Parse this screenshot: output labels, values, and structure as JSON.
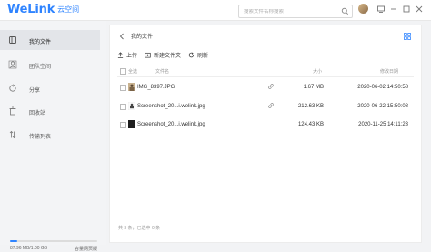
{
  "app": {
    "logo": "WeLink",
    "subtitle": "云空间"
  },
  "search": {
    "placeholder": "搜索文件名称搜索"
  },
  "sidebar": {
    "items": [
      {
        "label": "我的文件",
        "icon": "folder-icon"
      },
      {
        "label": "团队空间",
        "icon": "team-icon"
      },
      {
        "label": "分享",
        "icon": "share-icon"
      },
      {
        "label": "回收站",
        "icon": "trash-icon"
      },
      {
        "label": "传输列表",
        "icon": "transfer-icon"
      }
    ],
    "storage": {
      "used_text": "87.96 MB/1.00 GB",
      "upgrade_label": "容量网页版",
      "used_fraction": 0.086
    }
  },
  "breadcrumb": {
    "current": "我的文件"
  },
  "toolbar": {
    "upload_label": "上传",
    "new_folder_label": "新建文件夹",
    "refresh_label": "刷新"
  },
  "table": {
    "headers": {
      "select_all": "全选",
      "name": "文件名",
      "size": "大小",
      "date": "修改日期"
    },
    "rows": [
      {
        "name": "IMG_8397.JPG",
        "size": "1.67 MB",
        "date": "2020-06-02 14:50:58",
        "icon": "image-thumbnail-icon",
        "link": true
      },
      {
        "name": "Screenshot_20...i.welink.jpg",
        "size": "212.63 KB",
        "date": "2020-06-22 15:50:08",
        "icon": "screenshot-thumbnail-icon",
        "link": true
      },
      {
        "name": "Screenshot_20...i.welink.jpg",
        "size": "124.43 KB",
        "date": "2020-11-25 14:11:23",
        "icon": "dark-thumbnail-icon",
        "link": false
      }
    ]
  },
  "footer": {
    "summary": "共 3 条，已选中 0 条"
  },
  "colors": {
    "accent": "#2f84ff",
    "active_nav": "#e3e5e9"
  }
}
